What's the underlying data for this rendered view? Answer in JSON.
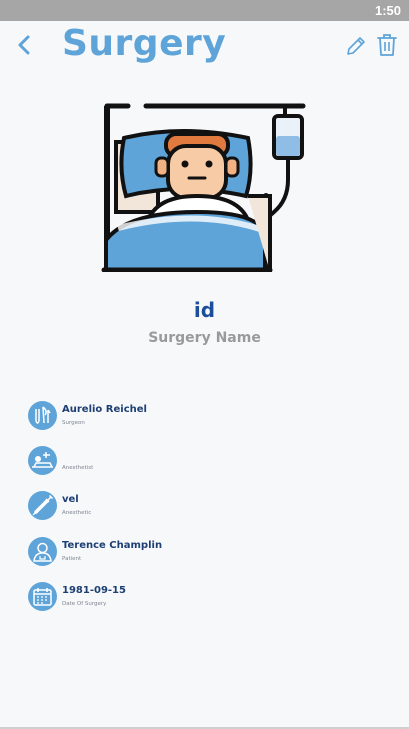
{
  "status_bar": {
    "time": "1:50"
  },
  "header": {
    "title": "Surgery"
  },
  "record": {
    "id": "id",
    "name": "Surgery Name"
  },
  "details": [
    {
      "icon": "surgeon-icon",
      "value": "Aurelio Reichel",
      "label": "Surgeon"
    },
    {
      "icon": "anesthetist-icon",
      "value": "",
      "label": "Anesthetist"
    },
    {
      "icon": "syringe-icon",
      "value": "vel",
      "label": "Anesthetic"
    },
    {
      "icon": "patient-icon",
      "value": "Terence Champlin",
      "label": "Patient"
    },
    {
      "icon": "calendar-icon",
      "value": "1981-09-15",
      "label": "Date Of Surgery"
    }
  ],
  "colors": {
    "accent": "#5ea4d9",
    "dark_blue": "#1d4e9c",
    "status_bar": "#a6a6a6"
  }
}
